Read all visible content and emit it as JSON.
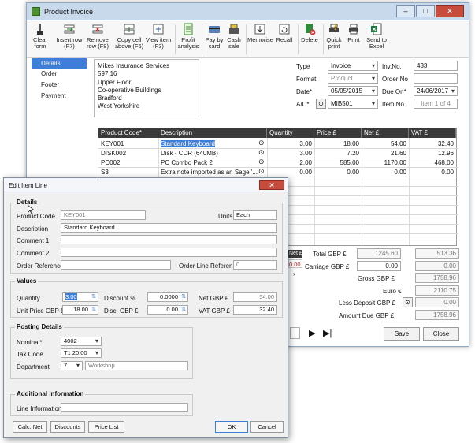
{
  "main": {
    "title": "Product Invoice",
    "ribbon": [
      {
        "label": "Clear form",
        "icon": "broom-icon"
      },
      {
        "label": "Insert row (F7)",
        "icon": "insert-row-icon"
      },
      {
        "label": "Remove row (F8)",
        "icon": "remove-row-icon"
      },
      {
        "label": "Copy cell above (F6)",
        "icon": "copy-cell-icon"
      },
      {
        "label": "View item (F3)",
        "icon": "view-item-icon"
      },
      {
        "label": "Profit analysis",
        "icon": "profit-analysis-icon"
      },
      {
        "label": "Pay by card",
        "icon": "card-icon"
      },
      {
        "label": "Cash sale",
        "icon": "cash-register-icon"
      },
      {
        "label": "Memorise",
        "icon": "memorise-icon"
      },
      {
        "label": "Recall",
        "icon": "recall-icon"
      },
      {
        "label": "Delete",
        "icon": "delete-icon"
      },
      {
        "label": "Quick print",
        "icon": "quick-print-icon"
      },
      {
        "label": "Print",
        "icon": "printer-icon"
      },
      {
        "label": "Send to Excel",
        "icon": "excel-icon"
      }
    ],
    "nav": [
      "Details",
      "Order",
      "Footer",
      "Payment"
    ],
    "address": [
      "Mikes Insurance Services",
      "597.16",
      "Upper Floor",
      "Co-operative Buildings",
      "Bradford",
      "West Yorkshire"
    ],
    "header": {
      "type_label": "Type",
      "type_value": "Invoice",
      "invno_label": "Inv.No.",
      "invno_value": "433",
      "format_label": "Format",
      "format_value": "Product",
      "orderno_label": "Order No",
      "orderno_value": "",
      "date_label": "Date*",
      "date_value": "05/05/2015",
      "dueon_label": "Due On*",
      "dueon_value": "24/06/2017",
      "ac_label": "A/C*",
      "ac_value": "MIB501",
      "itemno_label": "Item No.",
      "itemno_value": "Item 1 of 4"
    },
    "grid": {
      "columns": [
        "Product Code*",
        "Description",
        "Quantity",
        "Price £",
        "Net £",
        "VAT £"
      ],
      "rows": [
        [
          "KEY001",
          "Standard Keyboard",
          "3.00",
          "18.00",
          "54.00",
          "32.40"
        ],
        [
          "DISK002",
          "Disk - CDR (640MB)",
          "3.00",
          "7.20",
          "21.60",
          "12.96"
        ],
        [
          "PC002",
          "PC Combo Pack 2",
          "2.00",
          "585.00",
          "1170.00",
          "468.00"
        ],
        [
          "S3",
          "Extra note imported as an Sage '...",
          "0.00",
          "0.00",
          "0.00",
          "0.00"
        ]
      ]
    },
    "totals": {
      "net_label": "Net £",
      "net_value": "0.00",
      "total_label": "Total GBP £",
      "total_net": "1245.60",
      "total_vat": "513.36",
      "carriage_label": "Carriage GBP £",
      "carriage_net": "0.00",
      "carriage_vat": "0.00",
      "gross_label": "Gross GBP £",
      "gross_value": "1758.96",
      "euro_label": "Euro €",
      "euro_value": "2110.75",
      "deposit_label": "Less Deposit GBP £",
      "deposit_value": "0.00",
      "amountdue_label": "Amount Due GBP £",
      "amountdue_value": "1758.96"
    },
    "save_label": "Save",
    "close_label": "Close"
  },
  "dialog": {
    "title": "Edit Item Line",
    "details_title": "Details",
    "product_code_label": "Product Code",
    "product_code_value": "KEY001",
    "units_label": "Units",
    "units_value": "Each",
    "description_label": "Description",
    "description_value": "Standard Keyboard",
    "comment1_label": "Comment 1",
    "comment1_value": "",
    "comment2_label": "Comment 2",
    "comment2_value": "",
    "order_ref_label": "Order Reference",
    "order_ref_value": "",
    "order_line_ref_label": "Order Line Reference",
    "order_line_ref_value": "0",
    "values_title": "Values",
    "quantity_label": "Quantity",
    "quantity_value": "3.00",
    "discount_pct_label": "Discount %",
    "discount_pct_value": "0.0000",
    "net_gbp_label": "Net GBP £",
    "net_gbp_value": "54.00",
    "unit_price_label": "Unit Price GBP £",
    "unit_price_value": "18.00",
    "disc_gbp_label": "Disc. GBP £",
    "disc_gbp_value": "0.00",
    "vat_gbp_label": "VAT GBP £",
    "vat_gbp_value": "32.40",
    "posting_title": "Posting Details",
    "nominal_label": "Nominal*",
    "nominal_value": "4002",
    "taxcode_label": "Tax Code",
    "taxcode_value": "T1 20.00",
    "department_label": "Department",
    "department_value": "7",
    "department_name": "Workshop",
    "additional_title": "Additional Information",
    "line_info_label": "Line Information",
    "line_info_value": "",
    "calc_net_label": "Calc. Net",
    "discounts_label": "Discounts",
    "price_list_label": "Price List",
    "ok_label": "OK",
    "cancel_label": "Cancel"
  }
}
